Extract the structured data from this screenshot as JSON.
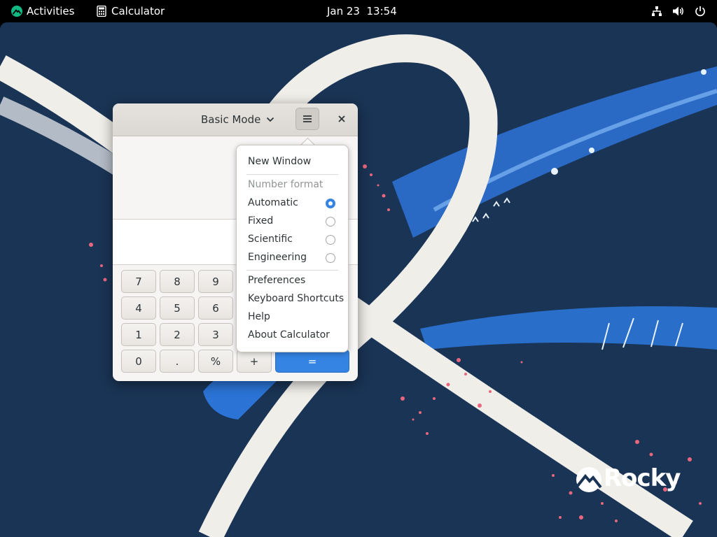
{
  "topbar": {
    "activities_label": "Activities",
    "app_label": "Calculator",
    "clock": "Jan 23  13:54",
    "icons": [
      "rocky-logo-icon",
      "calculator-icon",
      "network-icon",
      "volume-icon",
      "power-icon"
    ]
  },
  "desktop": {
    "brand_text": "Rocky"
  },
  "calculator": {
    "mode_label": "Basic Mode",
    "icons": [
      "chevron-down-icon",
      "hamburger-menu-icon",
      "close-icon"
    ],
    "keys": [
      "7",
      "8",
      "9",
      "4",
      "5",
      "6",
      "1",
      "2",
      "3",
      "0",
      ".",
      "%",
      "+",
      "="
    ]
  },
  "menu": {
    "new_window": "New Window",
    "number_format_header": "Number format",
    "formats": [
      {
        "label": "Automatic",
        "selected": true
      },
      {
        "label": "Fixed",
        "selected": false
      },
      {
        "label": "Scientific",
        "selected": false
      },
      {
        "label": "Engineering",
        "selected": false
      }
    ],
    "preferences": "Preferences",
    "keyboard_shortcuts": "Keyboard Shortcuts",
    "help": "Help",
    "about": "About Calculator"
  },
  "colors": {
    "desktop_bg": "#1a3455",
    "accent_blue": "#3584e4",
    "topbar_bg": "#000000",
    "ribbon_cream": "#f0eee9"
  }
}
